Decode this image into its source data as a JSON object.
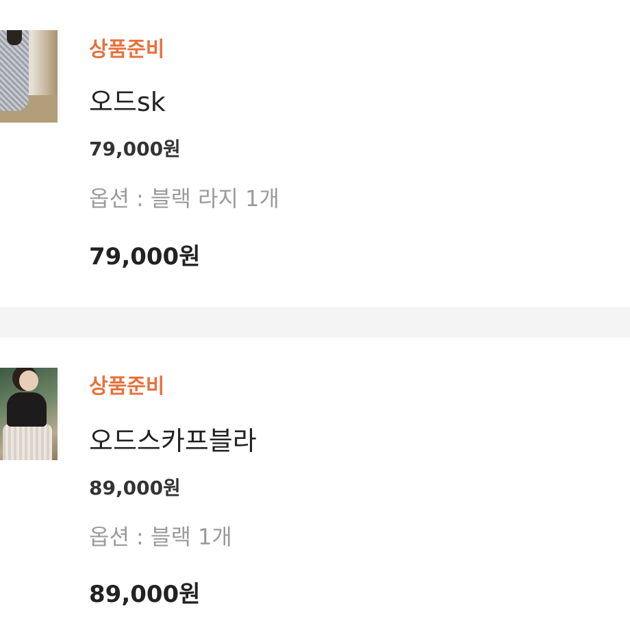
{
  "orders": [
    {
      "status": "상품준비",
      "name": "오드sk",
      "price": "79,000원",
      "option": "옵션 : 블랙 라지 1개",
      "total": "79,000원",
      "thumbnail": "product-photo"
    },
    {
      "status": "상품준비",
      "name": "오드스카프블라",
      "price": "89,000원",
      "option": "옵션 : 블랙 1개",
      "total": "89,000원",
      "thumbnail": "product-photo"
    }
  ],
  "colors": {
    "status": "#e8713c",
    "divider": "#f4f4f4",
    "option_text": "#9a9a9a"
  }
}
